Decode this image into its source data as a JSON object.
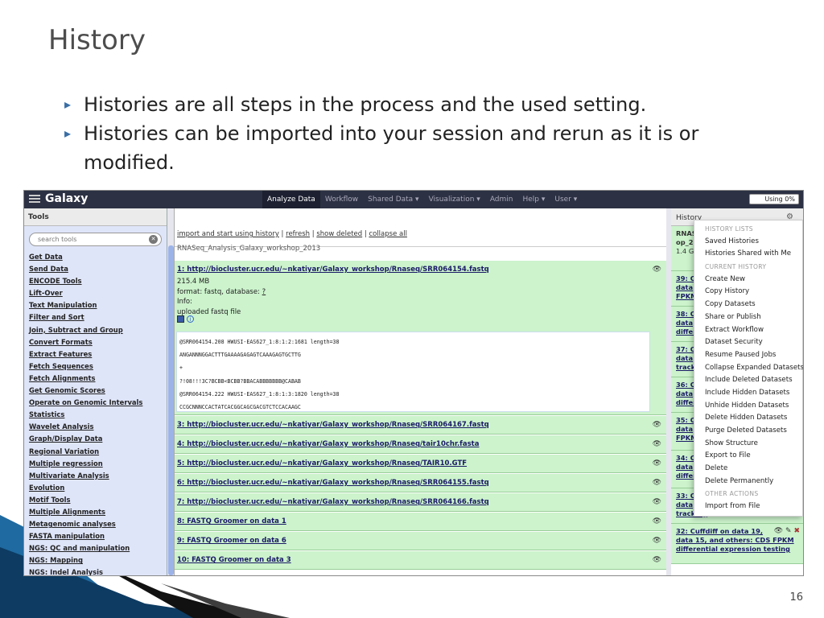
{
  "slide": {
    "title": "History",
    "bullets": [
      "Histories are all steps in the process and the used setting.",
      "Histories can be imported into your session and rerun as it is or modified."
    ],
    "page_number": "16"
  },
  "galaxy": {
    "brand": "Galaxy",
    "nav": [
      "Analyze Data",
      "Workflow",
      "Shared Data ▾",
      "Visualization ▾",
      "Admin",
      "Help ▾",
      "User ▾"
    ],
    "usage": "Using 0%",
    "tools_panel": {
      "header": "Tools",
      "search_placeholder": "search tools",
      "items": [
        "Get Data",
        "Send Data",
        "ENCODE Tools",
        "Lift-Over",
        "Text Manipulation",
        "Filter and Sort",
        "Join, Subtract and Group",
        "Convert Formats",
        "Extract Features",
        "Fetch Sequences",
        "Fetch Alignments",
        "Get Genomic Scores",
        "Operate on Genomic Intervals",
        "Statistics",
        "Wavelet Analysis",
        "Graph/Display Data",
        "Regional Variation",
        "Multiple regression",
        "Multivariate Analysis",
        "Evolution",
        "Motif Tools",
        "Multiple Alignments",
        "Metagenomic analyses",
        "FASTA manipulation",
        "NGS: QC and manipulation",
        "NGS: Mapping",
        "NGS: Indel Analysis"
      ]
    },
    "center": {
      "links": {
        "import": "import and start using history",
        "refresh": "refresh",
        "show_deleted": "show deleted",
        "collapse_all": "collapse all",
        "sep": " | "
      },
      "history_name": "RNASeq_Analysis_Galaxy_workshop_2013",
      "expanded_dataset": {
        "title": "1: http://biocluster.ucr.edu/~nkatiyar/Galaxy_workshop/Rnaseq/SRR064154.fastq",
        "size": "215.4 MB",
        "format_label": "format: fastq, database: ",
        "database": "?",
        "info_label": "Info:",
        "info": "uploaded fastq file",
        "peek": [
          "@SRR064154.208 HWUSI-EAS627_1:8:1:2:1681 length=38",
          "ANGANNNGGACTTTGAAAAGAGAGTCAAAGAGTGCTTG",
          "+",
          "?!08!!!3C?BCBB<BCBB?BBACABBBBBBB@CABAB",
          "@SRR064154.222 HWUSI-EAS627_1:8:1:3:1820 length=38",
          "CCGCNNNCCACTATCACGGCAGCGACGTCTCCACAAGC"
        ]
      },
      "datasets": [
        "3: http://biocluster.ucr.edu/~nkatiyar/Galaxy_workshop/Rnaseq/SRR064167.fastq",
        "4: http://biocluster.ucr.edu/~nkatiyar/Galaxy_workshop/Rnaseq/tair10chr.fasta",
        "5: http://biocluster.ucr.edu/~nkatiyar/Galaxy_workshop/Rnaseq/TAIR10.GTF",
        "6: http://biocluster.ucr.edu/~nkatiyar/Galaxy_workshop/Rnaseq/SRR064155.fastq",
        "7: http://biocluster.ucr.edu/~nkatiyar/Galaxy_workshop/Rnaseq/SRR064166.fastq",
        "8: FASTQ Groomer on data 1",
        "9: FASTQ Groomer on data 6",
        "10: FASTQ Groomer on data 3"
      ]
    },
    "history_panel": {
      "header": "History",
      "top": {
        "name_part1": "RNAS",
        "name_part2": "op_2",
        "size": "1.4 G"
      },
      "items": [
        {
          "line1": "39: C",
          "line2": "data",
          "line3": "FPKM"
        },
        {
          "line1": "38: C",
          "line2": "data",
          "line3": "differ"
        },
        {
          "line1": "37: C",
          "line2": "data",
          "line3": "track"
        },
        {
          "line1": "36: C",
          "line2": "data",
          "line3": "differ"
        },
        {
          "line1": "35: C",
          "line2": "data",
          "line3": "FPKM"
        },
        {
          "line1": "34: C",
          "line2": "data",
          "line3": "differ"
        },
        {
          "line1": "33: C",
          "line2": "data",
          "line3": "tracking"
        }
      ],
      "last_item": {
        "line1": "32: Cuffdiff on data 19,",
        "line2": "data 15, and others: CDS FPKM",
        "line3": "differential expression testing"
      }
    },
    "menu": {
      "sections": [
        {
          "header": "HISTORY LISTS",
          "items": [
            "Saved Histories",
            "Histories Shared with Me"
          ]
        },
        {
          "header": "CURRENT HISTORY",
          "items": [
            "Create New",
            "Copy History",
            "Copy Datasets",
            "Share or Publish",
            "Extract Workflow",
            "Dataset Security",
            "Resume Paused Jobs",
            "Collapse Expanded Datasets",
            "Include Deleted Datasets",
            "Include Hidden Datasets",
            "Unhide Hidden Datasets",
            "Delete Hidden Datasets",
            "Purge Deleted Datasets",
            "Show Structure",
            "Export to File",
            "Delete",
            "Delete Permanently"
          ]
        },
        {
          "header": "OTHER ACTIONS",
          "items": [
            "Import from File"
          ]
        }
      ]
    }
  }
}
